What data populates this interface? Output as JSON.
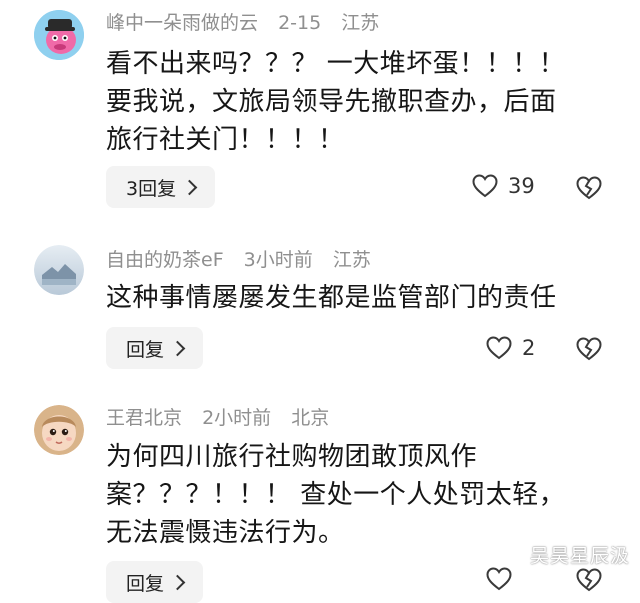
{
  "comments": [
    {
      "user": "峰中一朵雨做的云",
      "time": "2-15",
      "location": "江苏",
      "lines": [
        "看不出来吗？？？ 一大堆坏蛋！！！！",
        "要我说，文旅局领导先撤职查办，后面",
        "旅行社关门！！！！"
      ],
      "reply_label": "3回复",
      "likes": "39",
      "avatar_icon": "pink-cartoon-avatar-icon"
    },
    {
      "user": "自由的奶茶eF",
      "time": "3小时前",
      "location": "江苏",
      "lines": [
        "这种事情屡屡发生都是监管部门的责任"
      ],
      "reply_label": "回复",
      "likes": "2",
      "avatar_icon": "landscape-avatar-icon"
    },
    {
      "user": "王君北京",
      "time": "2小时前",
      "location": "北京",
      "lines": [
        "为何四川旅行社购物团敢顶风作",
        "案？？？！！！ 查处一个人处罚太轻，",
        "无法震慑违法行为。"
      ],
      "reply_label": "回复",
      "likes": "",
      "avatar_icon": "baby-face-avatar-icon"
    }
  ],
  "watermark": "吴昊星辰汲",
  "colors": {
    "meta_gray": "#8f8f8f",
    "text": "#161616",
    "reply_bg": "#f3f3f3"
  }
}
